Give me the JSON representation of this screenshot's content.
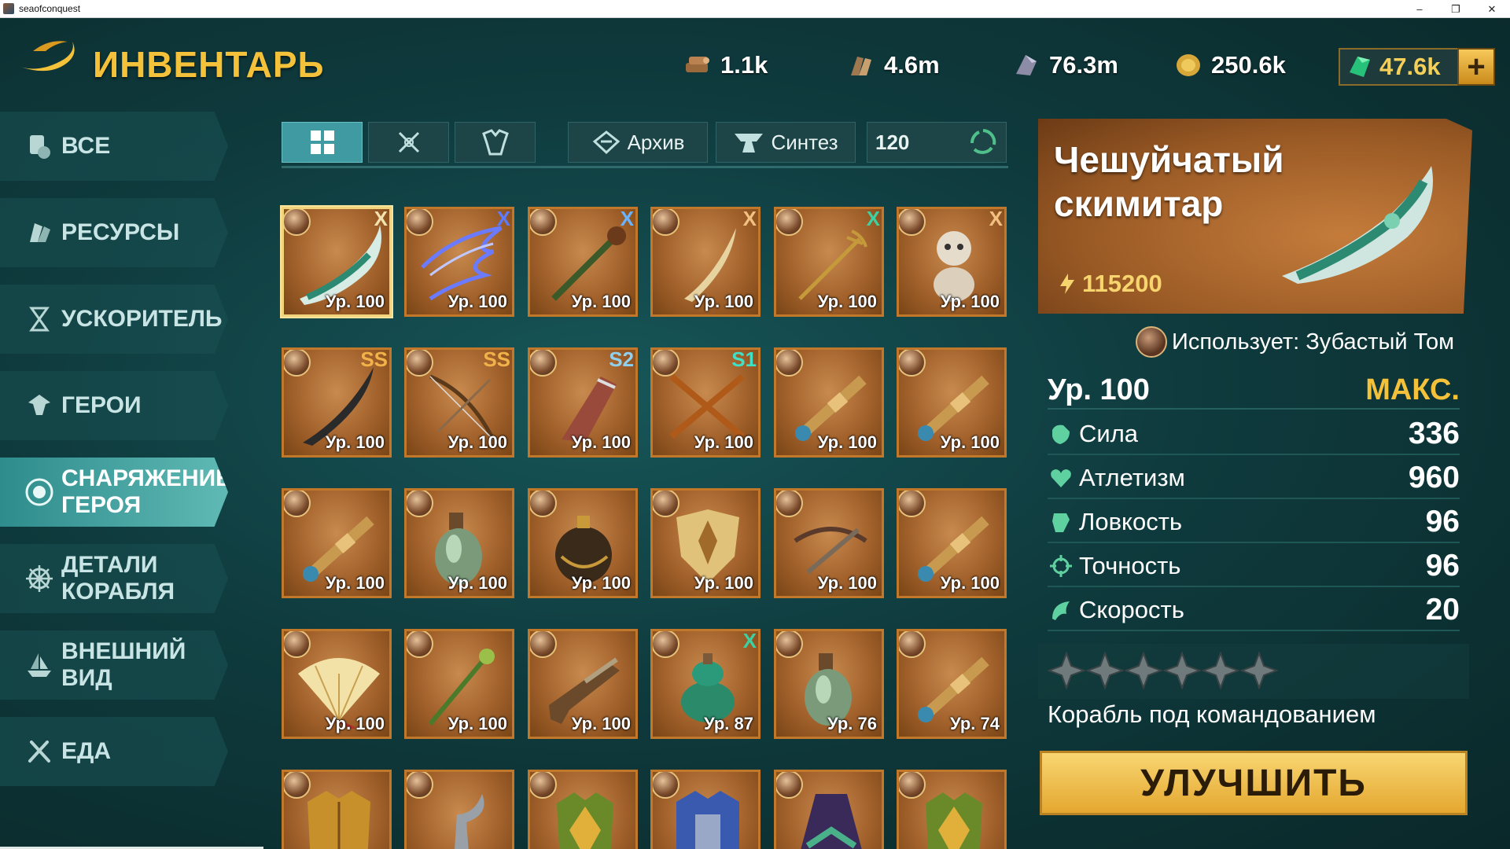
{
  "window": {
    "title": "seaofconquest",
    "controls": [
      "–",
      "❐",
      "✕"
    ]
  },
  "header": {
    "title": "ИНВЕНТАРЬ"
  },
  "resources": [
    {
      "icon": "wood-icon",
      "value": "1.1k"
    },
    {
      "icon": "lumber-icon",
      "value": "4.6m"
    },
    {
      "icon": "iron-icon",
      "value": "76.3m"
    },
    {
      "icon": "coin-icon",
      "value": "250.6k"
    }
  ],
  "gems": {
    "icon": "gem-icon",
    "value": "47.6k",
    "plus_label": "+"
  },
  "sidebar": {
    "items": [
      {
        "label": "ВСЕ",
        "icon": "all-icon"
      },
      {
        "label": "РЕСУРСЫ",
        "icon": "resources-icon"
      },
      {
        "label": "УСКОРИТЕЛЬ",
        "icon": "speedup-icon"
      },
      {
        "label": "ГЕРОИ",
        "icon": "heroes-icon"
      },
      {
        "label": "СНАРЯЖЕНИЕ ГЕРОЯ",
        "icon": "hero-gear-icon",
        "active": true
      },
      {
        "label": "ДЕТАЛИ КОРАБЛЯ",
        "icon": "ship-parts-icon"
      },
      {
        "label": "ВНЕШНИЙ ВИД",
        "icon": "appearance-icon"
      },
      {
        "label": "ЕДА",
        "icon": "food-icon"
      }
    ]
  },
  "toolbar": {
    "archive_label": "Архив",
    "synthesis_label": "Синтез",
    "count": "120"
  },
  "grid": {
    "items": [
      {
        "level": "Ур. 100",
        "kind": "scimitar",
        "mark": "X",
        "mark_color": "#f2e2b0",
        "selected": true
      },
      {
        "level": "Ур. 100",
        "kind": "lightning",
        "mark": "X",
        "mark_color": "#5c7bff"
      },
      {
        "level": "Ур. 100",
        "kind": "staff",
        "mark": "X",
        "mark_color": "#6ab4ff"
      },
      {
        "level": "Ур. 100",
        "kind": "sickle",
        "mark": "X",
        "mark_color": "#f2c081"
      },
      {
        "level": "Ур. 100",
        "kind": "trident",
        "mark": "X",
        "mark_color": "#3dd0a0"
      },
      {
        "level": "Ур. 100",
        "kind": "doll",
        "mark": "X",
        "mark_color": "#f2c081"
      },
      {
        "level": "Ур. 100",
        "kind": "blade",
        "mark": "SS",
        "mark_color": "#f2b24a"
      },
      {
        "level": "Ур. 100",
        "kind": "bow",
        "mark": "SS",
        "mark_color": "#f2b24a"
      },
      {
        "level": "Ур. 100",
        "kind": "cleaver",
        "mark": "S2",
        "mark_color": "#8fd0f0"
      },
      {
        "level": "Ур. 100",
        "kind": "crossguns",
        "mark": "S1",
        "mark_color": "#3ee0c8"
      },
      {
        "level": "Ур. 100",
        "kind": "spyglass",
        "mark": "",
        "mark_color": ""
      },
      {
        "level": "Ур. 100",
        "kind": "spyglass",
        "mark": "",
        "mark_color": ""
      },
      {
        "level": "Ур. 100",
        "kind": "spyglass",
        "mark": "",
        "mark_color": ""
      },
      {
        "level": "Ур. 100",
        "kind": "bottle",
        "mark": "",
        "mark_color": ""
      },
      {
        "level": "Ур. 100",
        "kind": "bomb",
        "mark": "",
        "mark_color": ""
      },
      {
        "level": "Ур. 100",
        "kind": "shield",
        "mark": "",
        "mark_color": ""
      },
      {
        "level": "Ур. 100",
        "kind": "crossbow",
        "mark": "",
        "mark_color": ""
      },
      {
        "level": "Ур. 100",
        "kind": "spyglass",
        "mark": "",
        "mark_color": ""
      },
      {
        "level": "Ур. 100",
        "kind": "fan",
        "mark": "",
        "mark_color": ""
      },
      {
        "level": "Ур. 100",
        "kind": "wand",
        "mark": "",
        "mark_color": ""
      },
      {
        "level": "Ур. 100",
        "kind": "pistol",
        "mark": "",
        "mark_color": ""
      },
      {
        "level": "Ур. 87",
        "kind": "potion",
        "mark": "X",
        "mark_color": "#3dd0a0"
      },
      {
        "level": "Ур. 76",
        "kind": "bottle",
        "mark": "",
        "mark_color": ""
      },
      {
        "level": "Ур. 74",
        "kind": "spyglass",
        "mark": "",
        "mark_color": ""
      },
      {
        "level": "",
        "kind": "armor-gold",
        "mark": "",
        "mark_color": ""
      },
      {
        "level": "",
        "kind": "hook",
        "mark": "",
        "mark_color": ""
      },
      {
        "level": "",
        "kind": "armor-green",
        "mark": "",
        "mark_color": ""
      },
      {
        "level": "",
        "kind": "armor-blue",
        "mark": "",
        "mark_color": ""
      },
      {
        "level": "",
        "kind": "cloak",
        "mark": "",
        "mark_color": ""
      },
      {
        "level": "",
        "kind": "armor-green",
        "mark": "",
        "mark_color": ""
      }
    ]
  },
  "detail": {
    "name": "Чешуйчатый скимитар",
    "price": "115200",
    "used_by": "Использует: Зубастый Том",
    "level": "Ур. 100",
    "max_label": "МАКС.",
    "stats": [
      {
        "name": "Сила",
        "value": "336",
        "icon": "strength-icon"
      },
      {
        "name": "Атлетизм",
        "value": "960",
        "icon": "heart-icon"
      },
      {
        "name": "Ловкость",
        "value": "96",
        "icon": "agility-icon"
      },
      {
        "name": "Точность",
        "value": "96",
        "icon": "accuracy-icon"
      },
      {
        "name": "Скорость",
        "value": "20",
        "icon": "speed-icon"
      }
    ],
    "stars_total": 6,
    "ship_command": "Корабль под командованием",
    "upgrade_label": "УЛУЧШИТЬ"
  },
  "colors": {
    "accent": "#f4c23a",
    "panel": "#0f3b3e",
    "slot": "#a3622c",
    "active_tab": "#3f9aa2"
  }
}
